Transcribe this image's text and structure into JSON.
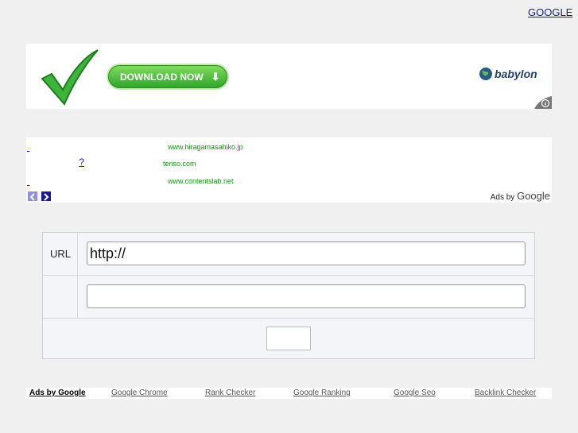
{
  "top_link": "GOOGLE",
  "banner": {
    "download_label": "DOWNLOAD NOW",
    "brand": "babylon",
    "check_icon": "checkmark-icon",
    "info_icon": "info-icon"
  },
  "ads": {
    "items": [
      {
        "title": "",
        "url": "www.hiragamasahiko.jp"
      },
      {
        "title": "?",
        "url": "tenso.com"
      },
      {
        "title": "",
        "url": "www.contentslab.net"
      }
    ],
    "ads_by_prefix": "Ads by",
    "ads_by_brand": "Google"
  },
  "form": {
    "url_label": "URL",
    "url_value": "http://",
    "second_value": "",
    "submit_label": ""
  },
  "bottom_links": {
    "ads_label": "Ads by Google",
    "links": [
      "Google Chrome",
      "Rank Checker",
      "Google Ranking",
      "Google Seo",
      "Backlink Checker"
    ]
  }
}
